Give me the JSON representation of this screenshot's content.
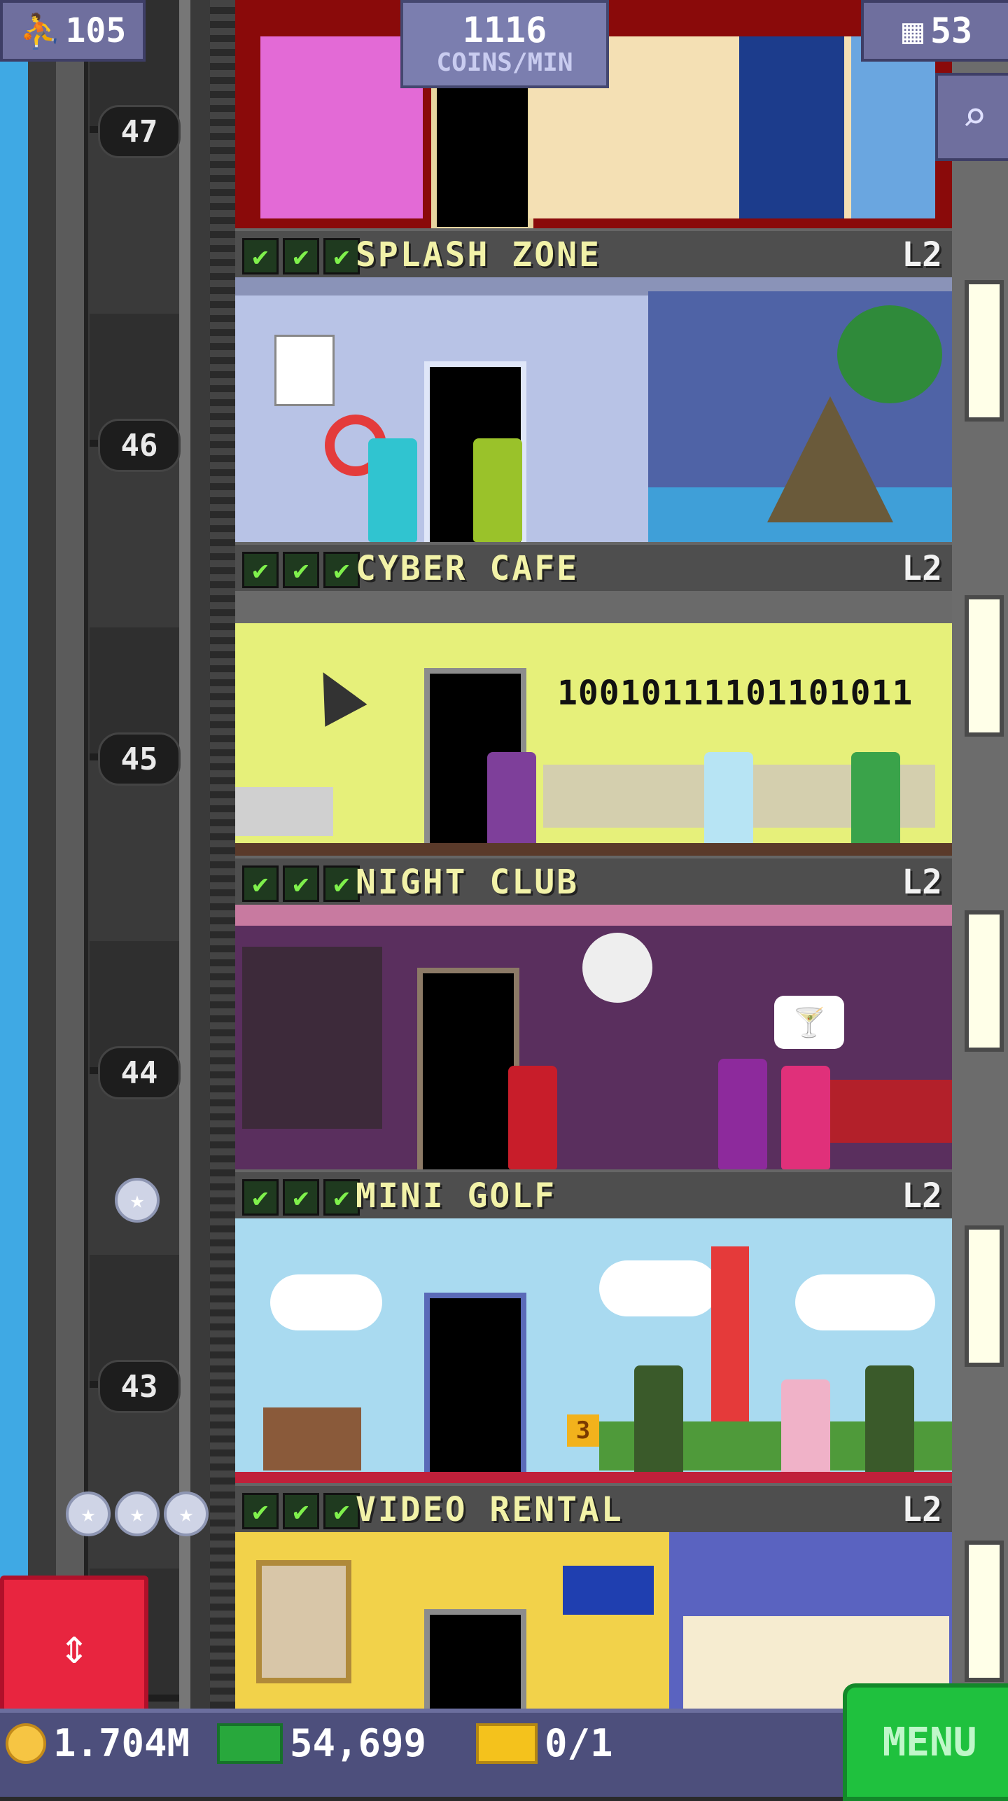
{
  "hud": {
    "population": "105",
    "coins_per_min": "1116",
    "coins_per_min_label": "COINS/MIN",
    "floor_count": "53",
    "person_icon": "person-icon",
    "building_icon": "building-icon",
    "search_icon": "magnifier-icon"
  },
  "elevator": {
    "floor_numbers": [
      "47",
      "46",
      "45",
      "44",
      "43"
    ],
    "button_icon": "up-down-arrows-icon"
  },
  "floors": [
    {
      "name": "SPLASH ZONE",
      "level": "L2",
      "checks": [
        "✔",
        "✔",
        "✔"
      ]
    },
    {
      "name": "CYBER CAFE",
      "level": "L2",
      "checks": [
        "✔",
        "✔",
        "✔"
      ],
      "sign": "10010111101101011"
    },
    {
      "name": "NIGHT CLUB",
      "level": "L2",
      "checks": [
        "✔",
        "✔",
        "✔"
      ]
    },
    {
      "name": "MINI GOLF",
      "level": "L2",
      "checks": [
        "✔",
        "✔",
        "✔"
      ],
      "hole": "3"
    },
    {
      "name": "VIDEO RENTAL",
      "level": "L2",
      "checks": [
        "✔",
        "✔",
        "✔"
      ]
    }
  ],
  "bottom_bar": {
    "coins": "1.704M",
    "bux": "54,699",
    "vip": "0/1",
    "menu_label": "MENU"
  },
  "colors": {
    "banner_text": "#f2f2a8",
    "check_green": "#7ff04c",
    "menu_green": "#1fc13e",
    "elevator_red": "#e8253f",
    "hud_purple": "#6f6f9e"
  }
}
